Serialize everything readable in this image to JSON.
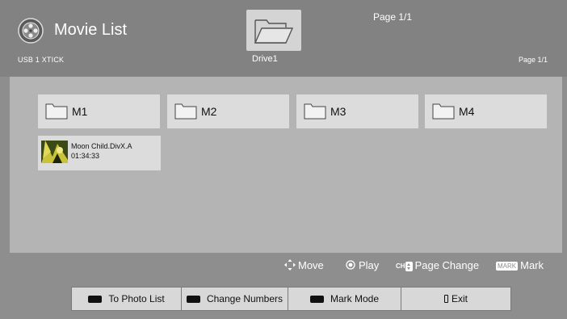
{
  "header": {
    "app_icon": "movie-reel-icon",
    "title": "Movie List",
    "device": "USB 1 XTICK",
    "drive_label": "Drive1",
    "page_top": "Page 1/1",
    "page_right": "Page 1/1"
  },
  "browser": {
    "folders": [
      {
        "label": "M1",
        "icon": "folder-icon"
      },
      {
        "label": "M2",
        "icon": "folder-icon"
      },
      {
        "label": "M3",
        "icon": "folder-icon"
      },
      {
        "label": "M4",
        "icon": "folder-icon"
      }
    ],
    "files": [
      {
        "name": "Moon Child.DivX.A",
        "duration": "01:34:33",
        "icon": "video-thumbnail"
      }
    ]
  },
  "hints": {
    "move": "Move",
    "play": "Play",
    "ch_badge": "CH",
    "page_change": "Page Change",
    "mark_badge": "MARK",
    "mark": "Mark"
  },
  "buttons": {
    "photo_list": "To Photo List",
    "change_numbers": "Change Numbers",
    "mark_mode": "Mark Mode",
    "exit": "Exit"
  },
  "colors": {
    "background": "#8e8e8e",
    "header": "#828282",
    "browser": "#b4b4b4",
    "item": "#dcdcdc",
    "text_light": "#ffffff"
  }
}
